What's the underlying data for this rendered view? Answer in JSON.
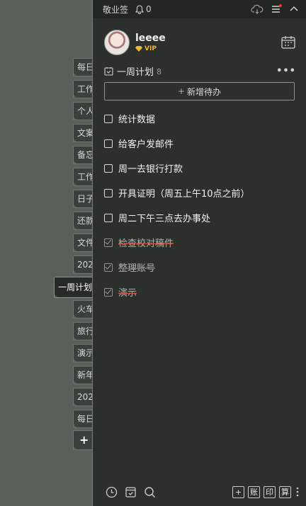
{
  "tabs": [
    "每日",
    "工作",
    "个人",
    "文案",
    "备忘",
    "工作",
    "日子",
    "还款",
    "文件",
    "202",
    "一周计划",
    "火车",
    "旅行",
    "演示",
    "新年",
    "202",
    "每日",
    "+"
  ],
  "topbar": {
    "app_name": "敬业签",
    "notification_count": "0"
  },
  "user": {
    "name": "leeee",
    "badge": "VIP"
  },
  "section": {
    "title": "一周计划",
    "count": "8",
    "add_label": "新增待办"
  },
  "todos": [
    {
      "text": "统计数据",
      "done": false
    },
    {
      "text": "给客户发邮件",
      "done": false
    },
    {
      "text": "周一去银行打款",
      "done": false
    },
    {
      "text": "开具证明（周五上午10点之前）",
      "done": false
    },
    {
      "text": "周二下午三点去办事处",
      "done": false
    },
    {
      "text": "检查校对稿件",
      "done": true
    },
    {
      "text": "整理账号",
      "done": true
    },
    {
      "text": "演示",
      "done": true
    }
  ],
  "bottom": {
    "btn_add": "+",
    "btn_account": "账",
    "btn_print": "印",
    "btn_calc": "算"
  },
  "colors": {
    "panel_bg": "#2b302c",
    "desktop_bg": "#586058",
    "vip": "#f0b63c",
    "strike": "#d6584f",
    "notify_dot": "#e53935"
  }
}
